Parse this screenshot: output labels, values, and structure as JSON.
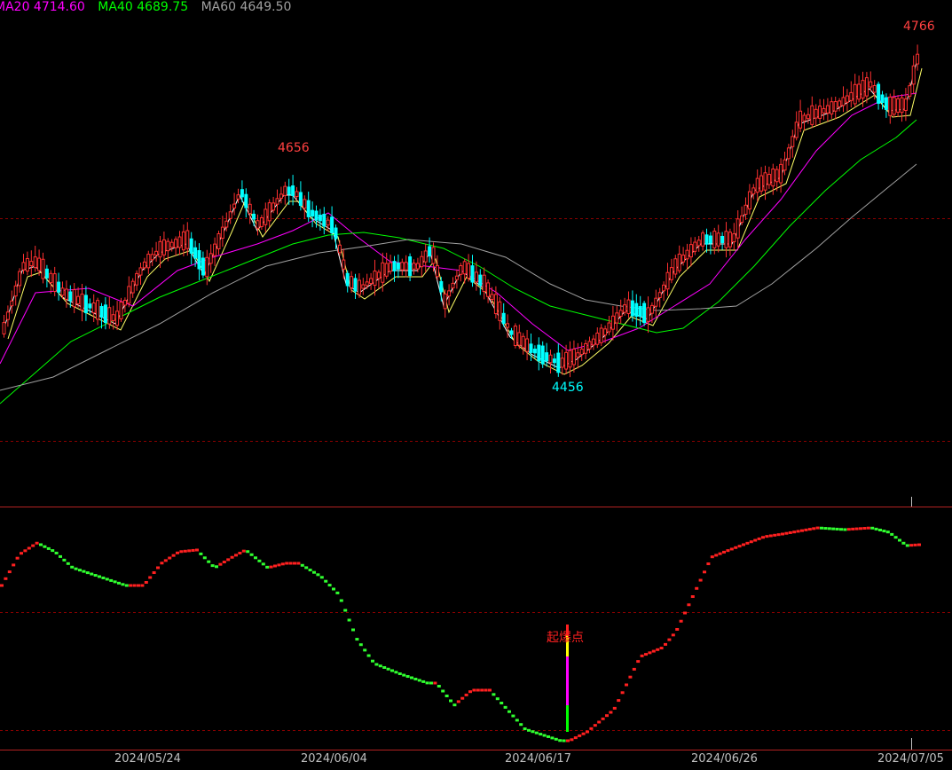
{
  "legend": {
    "ma20": "MA20 4714.60",
    "ma40": "MA40 4689.75",
    "ma60": "MA60 4649.50",
    "ma20_color": "#ff00ff",
    "ma40_color": "#00ff00",
    "ma60_color": "#a0a0a0"
  },
  "annotations": {
    "high_label": "4766",
    "mid_high_label": "4656",
    "low_label": "4456",
    "signal_label": "起爆点"
  },
  "x_axis": {
    "dates": [
      "2024/05/24",
      "2024/06/04",
      "2024/06/17",
      "2024/06/26",
      "2024/07/05"
    ]
  },
  "colors": {
    "up": "#ff3030",
    "down": "#00ffff",
    "grid": "#8b0000",
    "osc_up": "#ff2020",
    "osc_down": "#30ff30"
  },
  "chart_data": {
    "type": "candlestick",
    "price_high_marked": 4766,
    "price_high_mid": 4656,
    "price_low_marked": 4456,
    "last_values": {
      "MA20": 4714.6,
      "MA40": 4689.75,
      "MA60": 4649.5
    },
    "dates_shown": [
      "2024/05/24",
      "2024/06/04",
      "2024/06/17",
      "2024/06/26",
      "2024/07/05"
    ],
    "sub_indicator": {
      "signal": "起爆点",
      "signal_date": "2024/06/17"
    }
  }
}
